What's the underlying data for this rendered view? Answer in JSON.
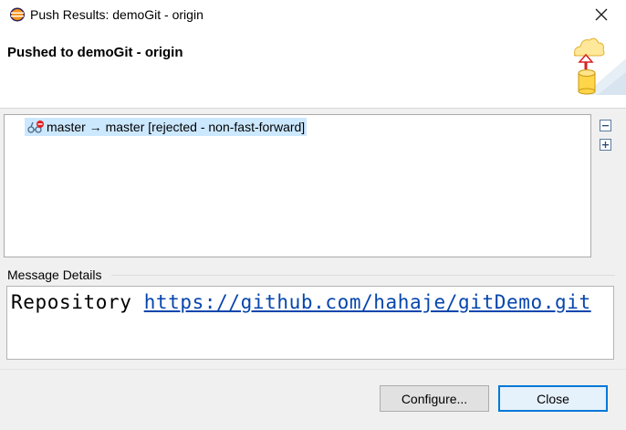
{
  "window": {
    "title": "Push Results: demoGit - origin",
    "app_icon": "eclipse-icon",
    "close_icon": "close-icon"
  },
  "header": {
    "heading": "Pushed to demoGit - origin",
    "wizard_icon": "push-to-cloud-icon"
  },
  "results": {
    "rows": [
      {
        "icon": "rejected-ref-icon",
        "label": "master → master [rejected - non-fast-forward]"
      }
    ],
    "collapse_icon": "collapse-all-icon",
    "expand_icon": "expand-all-icon"
  },
  "message": {
    "label": "Message Details",
    "prefix": "Repository",
    "url": "https://github.com/hahaje/gitDemo.git"
  },
  "buttons": {
    "configure": "Configure...",
    "close": "Close"
  },
  "colors": {
    "selection": "#cce8ff",
    "link": "#0645ad",
    "default_button_border": "#0078d7"
  }
}
